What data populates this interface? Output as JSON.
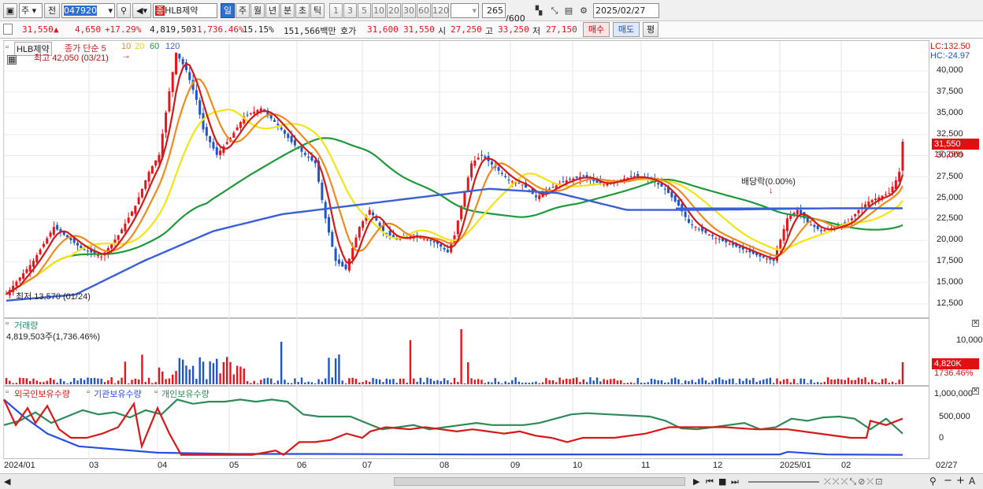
{
  "toolbar": {
    "market_select": "주",
    "prev_label": "전",
    "stock_code": "047920",
    "stock_name": "HLB제약",
    "stock_badge": "종",
    "periods": [
      "일",
      "주",
      "월",
      "년",
      "분",
      "초",
      "틱"
    ],
    "active_period": "일",
    "minute_options": [
      "1",
      "3",
      "5",
      "10",
      "20",
      "30",
      "60",
      "120"
    ],
    "count_value": "265",
    "count_total": "/600",
    "date_value": "2025/02/27"
  },
  "quote": {
    "price": "31,550",
    "arrow": "▲",
    "change": "4,650",
    "change_pct": "+17.29%",
    "volume": "4,819,503",
    "volume_ratio": "1,736.46%",
    "turnover": "15.15%",
    "trade_value": "151,566백만",
    "hoga_label": "호가",
    "ask": "31,600",
    "bid": "31,550",
    "open_label": "시",
    "open": "27,250",
    "high_label": "고",
    "high": "33,250",
    "low_label": "저",
    "low": "27,150",
    "buy_button": "매수",
    "sell_button": "매도",
    "eval_button": "평"
  },
  "price_panel": {
    "stock_label": "HLB제약",
    "ma_label": "종가 단순 5",
    "ma_periods": [
      "10",
      "20",
      "60",
      "120"
    ],
    "high_annotation": "최고 42,050 (03/21)",
    "low_annotation": "최저 13,570 (01/24)",
    "dividend_annotation": "배당락(0.00%)",
    "lc": "LC:132.50",
    "hc": "HC:-24.97",
    "current_tag": "31,550",
    "current_pct": "17.29%",
    "y_ticks": [
      "40,000",
      "37,500",
      "35,000",
      "32,500",
      "30,000",
      "27,500",
      "25,000",
      "22,500",
      "20,000",
      "17,500",
      "15,000",
      "12,500"
    ]
  },
  "volume_panel": {
    "title": "거래량",
    "value": "4,819,503주(1,736.46%)",
    "y_tick": "10,000K",
    "current_tag": "4,820K",
    "current_pct": "1736.46%"
  },
  "holdings_panel": {
    "series_labels": [
      "외국인보유수량",
      "기관보유수량",
      "개인보유수량"
    ],
    "y_ticks": [
      "1,000,000",
      "500,000",
      "0"
    ]
  },
  "x_axis": [
    "2024/01",
    "03",
    "04",
    "05",
    "06",
    "07",
    "08",
    "09",
    "10",
    "11",
    "12",
    "2025/01",
    "02"
  ],
  "x_axis_end": "02/27",
  "colors": {
    "up": "#e8141c",
    "down": "#1f55c8",
    "ma5": "#d31919",
    "ma10": "#f08a1e",
    "ma20": "#f4e414",
    "ma60": "#1e9a3a",
    "ma120": "#3a5fd6",
    "foreign": "#d81818",
    "inst": "#2850e0",
    "indiv": "#2e8b57"
  },
  "chart_data": {
    "type": "line",
    "title": "HLB제약",
    "x": [
      "2024/01",
      "03",
      "04",
      "05",
      "06",
      "07",
      "08",
      "09",
      "10",
      "11",
      "12",
      "2025/01",
      "02",
      "02/27"
    ],
    "series": [
      {
        "name": "종가 단순 5",
        "values": [
          13570,
          21500,
          39000,
          34500,
          17500,
          19500,
          25500,
          26500,
          25500,
          17500,
          23000,
          24500,
          25500,
          31550
        ]
      },
      {
        "name": "60",
        "values": [
          13000,
          15500,
          23000,
          29500,
          30000,
          26500,
          24000,
          26000,
          26000,
          23500,
          21500,
          21300,
          23000,
          24500
        ]
      },
      {
        "name": "120",
        "values": [
          12800,
          13500,
          17500,
          21000,
          23000,
          24000,
          25000,
          26000,
          25500,
          23500,
          23500,
          23600,
          23700,
          23700
        ]
      }
    ],
    "high": {
      "value": 42050,
      "date": "03/21"
    },
    "low": {
      "value": 13570,
      "date": "01/24"
    },
    "ylim": [
      11500,
      42500
    ]
  }
}
